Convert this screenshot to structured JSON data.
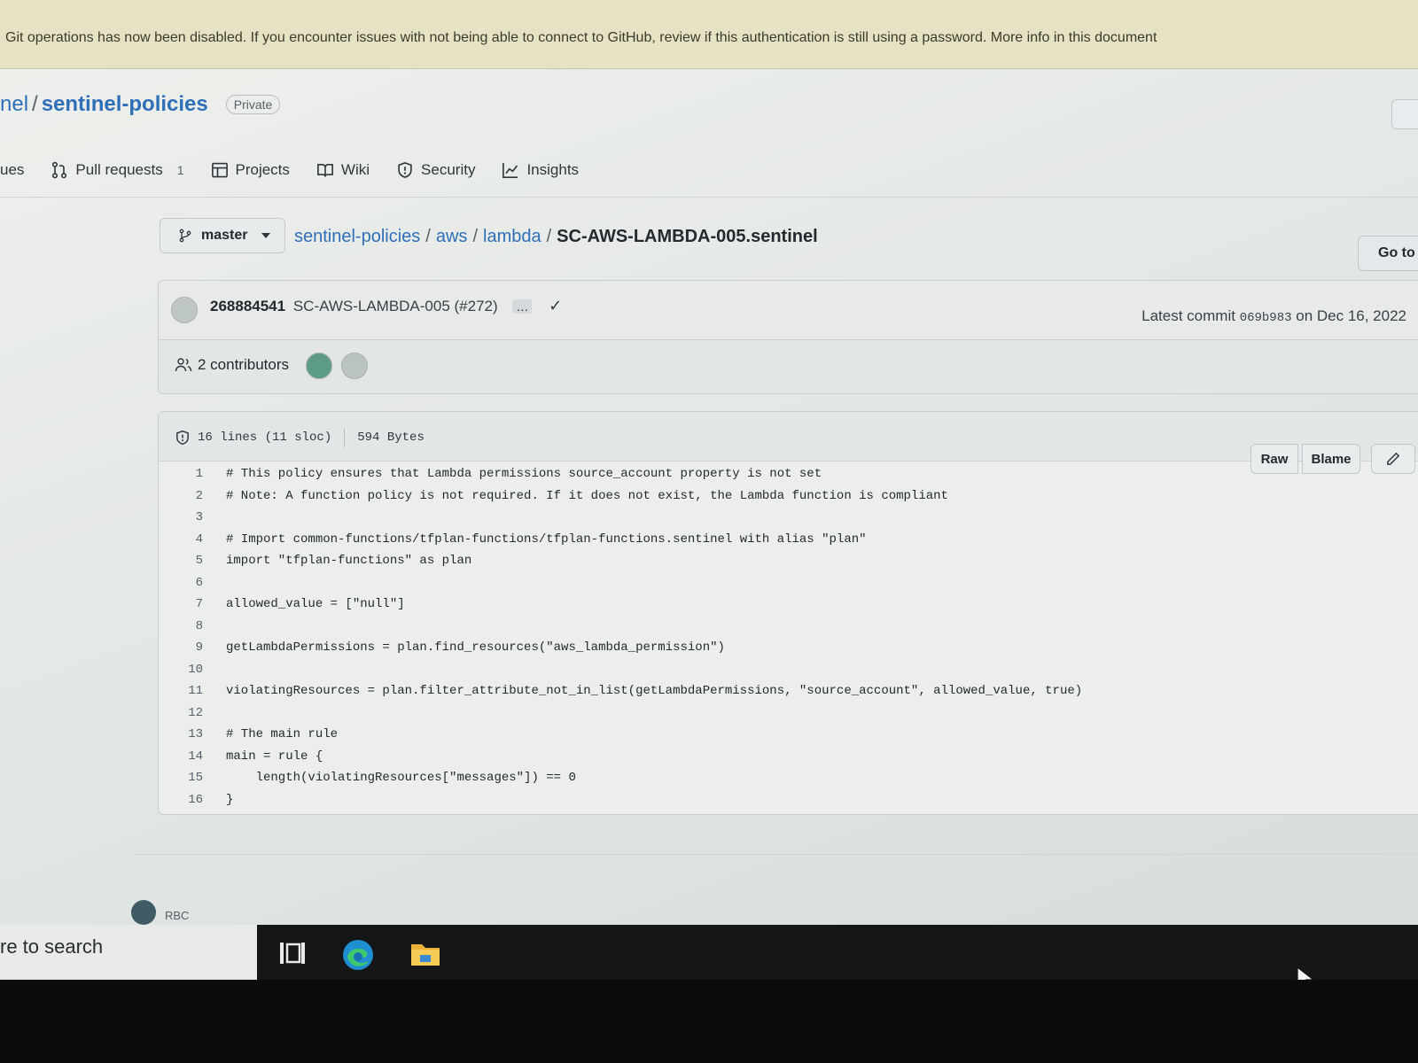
{
  "banner": {
    "text": "Git operations has now been disabled. If you encounter issues with not being able to connect to GitHub, review if this authentication is still using a password. More info in this document"
  },
  "repo": {
    "owner": "nel",
    "name": "sentinel-policies",
    "visibility": "Private"
  },
  "tabs": [
    {
      "label": "ues",
      "icon": "issue-icon"
    },
    {
      "label": "Pull requests",
      "icon": "pull-request-icon",
      "count": "1"
    },
    {
      "label": "Projects",
      "icon": "table-icon"
    },
    {
      "label": "Wiki",
      "icon": "book-icon"
    },
    {
      "label": "Security",
      "icon": "shield-icon"
    },
    {
      "label": "Insights",
      "icon": "graph-icon"
    }
  ],
  "branch": "master",
  "breadcrumb": {
    "root": "sentinel-policies",
    "dir1": "aws",
    "dir2": "lambda",
    "file": "SC-AWS-LAMBDA-005.sentinel"
  },
  "goto_label": "Go to",
  "commit": {
    "author": "268884541",
    "message": "SC-AWS-LAMBDA-005 (#272)",
    "dots": "…",
    "check": "✓",
    "latest_prefix": "Latest commit",
    "sha": "069b983",
    "date": "on Dec 16, 2022"
  },
  "contributors": "2 contributors",
  "file": {
    "lines": "16 lines (11 sloc)",
    "size": "594 Bytes",
    "raw_label": "Raw",
    "blame_label": "Blame"
  },
  "code": [
    {
      "n": "1",
      "text": "# This policy ensures that Lambda permissions source_account property is not set"
    },
    {
      "n": "2",
      "text": "# Note: A function policy is not required. If it does not exist, the Lambda function is compliant"
    },
    {
      "n": "3",
      "text": ""
    },
    {
      "n": "4",
      "text": "# Import common-functions/tfplan-functions/tfplan-functions.sentinel with alias \"plan\""
    },
    {
      "n": "5",
      "text": "import \"tfplan-functions\" as plan"
    },
    {
      "n": "6",
      "text": ""
    },
    {
      "n": "7",
      "text": "allowed_value = [\"null\"]"
    },
    {
      "n": "8",
      "text": ""
    },
    {
      "n": "9",
      "text": "getLambdaPermissions = plan.find_resources(\"aws_lambda_permission\")"
    },
    {
      "n": "10",
      "text": ""
    },
    {
      "n": "11",
      "text": "violatingResources = plan.filter_attribute_not_in_list(getLambdaPermissions, \"source_account\", allowed_value, true)"
    },
    {
      "n": "12",
      "text": ""
    },
    {
      "n": "13",
      "text": "# The main rule"
    },
    {
      "n": "14",
      "text": "main = rule {"
    },
    {
      "n": "15",
      "text": "    length(violatingResources[\"messages\"]) == 0"
    },
    {
      "n": "16",
      "text": "}"
    }
  ],
  "footer_user": "RBC",
  "taskbar": {
    "search_text": "re to search"
  }
}
